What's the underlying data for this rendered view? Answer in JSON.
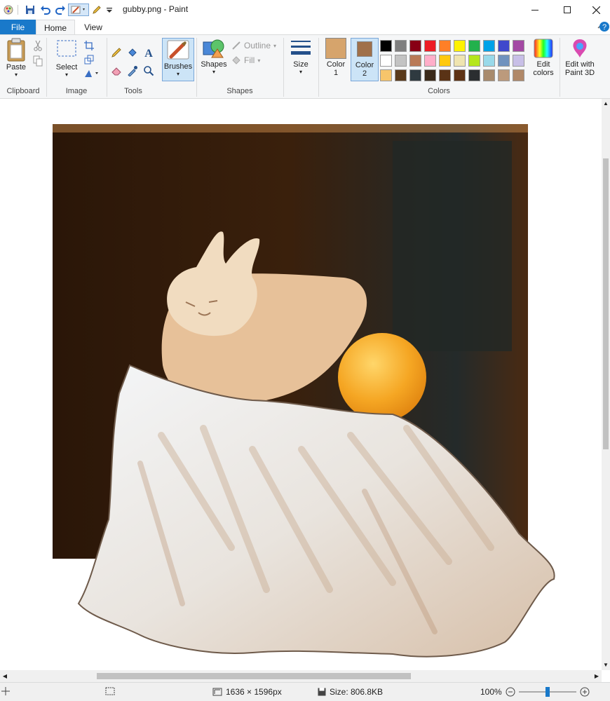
{
  "window": {
    "title": "gubby.png - Paint",
    "minimize_icon": "minimize-icon",
    "maximize_icon": "maximize-icon",
    "close_icon": "close-icon"
  },
  "quick_access": {
    "app_icon": "paint-app-icon",
    "save_icon": "save-icon",
    "undo_icon": "undo-icon",
    "redo_icon": "redo-icon",
    "customize_icon": "chevron-down-icon"
  },
  "tabs": {
    "file": "File",
    "home": "Home",
    "view": "View"
  },
  "ribbon": {
    "clipboard": {
      "paste": "Paste",
      "label": "Clipboard"
    },
    "image": {
      "select": "Select",
      "label": "Image"
    },
    "tools": {
      "label": "Tools"
    },
    "brushes": {
      "label": "Brushes"
    },
    "shapes": {
      "shapes": "Shapes",
      "outline": "Outline",
      "fill": "Fill",
      "label": "Shapes"
    },
    "size": {
      "label": "Size"
    },
    "colors": {
      "color1": "Color 1",
      "color2": "Color 2",
      "edit_colors": "Edit colors",
      "edit_with_paint3d": "Edit with Paint 3D",
      "label": "Colors",
      "color1_value": "#d6a46c",
      "color2_value": "#a0704a",
      "palette": [
        [
          "#000000",
          "#7f7f7f",
          "#880015",
          "#ed1c24",
          "#ff7f27",
          "#fff200",
          "#22b14c",
          "#00a2e8",
          "#3f48cc",
          "#a349a4"
        ],
        [
          "#ffffff",
          "#c3c3c3",
          "#b97a57",
          "#ffaec9",
          "#ffc90e",
          "#efe4b0",
          "#b5e61d",
          "#99d9ea",
          "#7092be",
          "#c8bfe7"
        ],
        [
          "#f7c56b",
          "#5a3a1a",
          "#2f3a40",
          "#3b2a1a",
          "#5a3316",
          "#5e3214",
          "#2b2e30",
          "#a88a6c",
          "#bc9a7c",
          "#b08868"
        ]
      ]
    }
  },
  "status": {
    "dimensions": "1636 × 1596px",
    "size": "Size: 806.8KB",
    "zoom": "100%",
    "zoom_level": 1.0
  }
}
